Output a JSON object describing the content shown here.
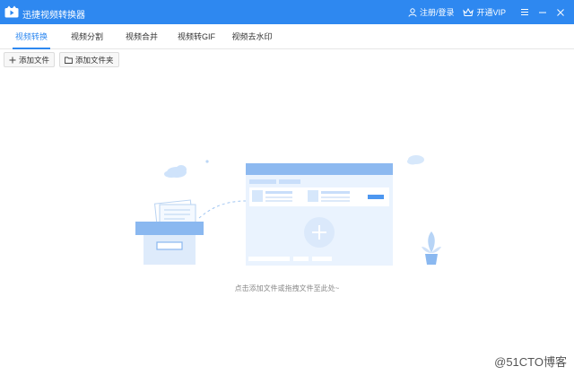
{
  "window": {
    "title": "迅捷视频转换器",
    "register_login": "注册/登录",
    "vip": "开通VIP",
    "accent": "#2e88f0"
  },
  "icons": [
    "app-logo-icon",
    "user-icon",
    "crown-icon",
    "menu-icon",
    "minimize-icon",
    "close-icon",
    "plus-icon",
    "folder-icon"
  ],
  "tabs": [
    {
      "label": "视频转换",
      "active": true
    },
    {
      "label": "视频分割",
      "active": false
    },
    {
      "label": "视频合并",
      "active": false
    },
    {
      "label": "视频转GIF",
      "active": false
    },
    {
      "label": "视频去水印",
      "active": false
    }
  ],
  "toolbar": {
    "add_file": "添加文件",
    "add_folder": "添加文件夹"
  },
  "main": {
    "hint": "点击添加文件或拖拽文件至此处~"
  },
  "watermark": "@51CTO博客"
}
